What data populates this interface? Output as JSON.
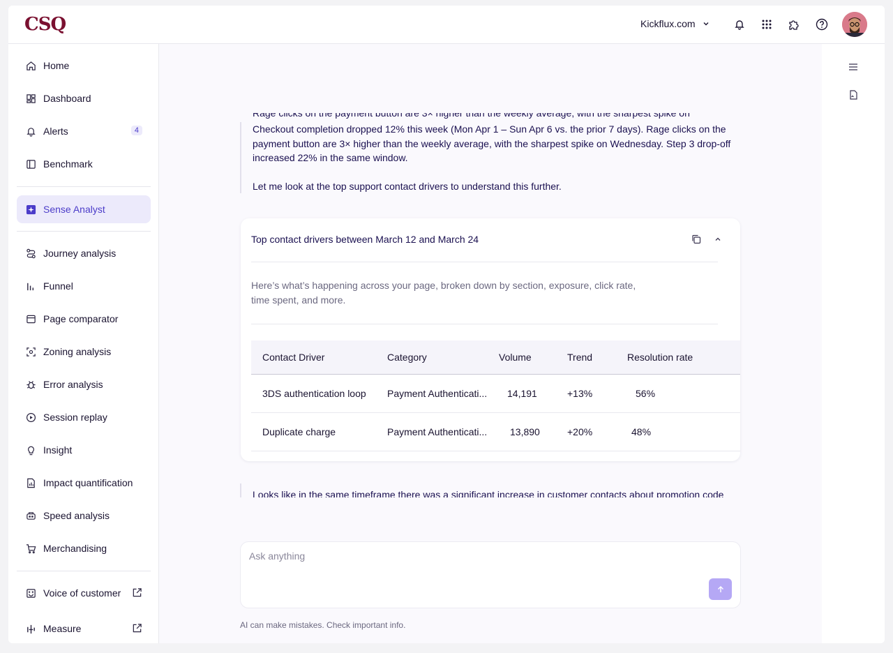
{
  "header": {
    "logo": "CSQ",
    "domain": "Kickflux.com"
  },
  "sidebar": {
    "items": [
      {
        "label": "Home",
        "icon": "home-icon"
      },
      {
        "label": "Dashboard",
        "icon": "dashboard-icon"
      },
      {
        "label": "Alerts",
        "icon": "bell-icon",
        "badge": "4"
      },
      {
        "label": "Benchmark",
        "icon": "benchmark-icon"
      },
      {
        "label": "Sense Analyst",
        "icon": "sparkle-icon",
        "active": true
      },
      {
        "label": "Journey analysis",
        "icon": "journey-icon"
      },
      {
        "label": "Funnel",
        "icon": "funnel-icon"
      },
      {
        "label": "Page comparator",
        "icon": "page-icon"
      },
      {
        "label": "Zoning analysis",
        "icon": "zoning-icon"
      },
      {
        "label": "Error analysis",
        "icon": "bug-icon"
      },
      {
        "label": "Session replay",
        "icon": "play-icon"
      },
      {
        "label": "Insight",
        "icon": "lightbulb-icon"
      },
      {
        "label": "Impact quantification",
        "icon": "report-icon"
      },
      {
        "label": "Speed analysis",
        "icon": "speed-icon"
      },
      {
        "label": "Merchandising",
        "icon": "cart-icon"
      },
      {
        "label": "Voice of customer",
        "icon": "voice-icon",
        "external": true
      },
      {
        "label": "Measure",
        "icon": "measure-icon",
        "external": true
      }
    ]
  },
  "chat": {
    "clipped_line": "Rage clicks on the payment button are 3× higher than the weekly average, with the sharpest spike on",
    "message_1": "Checkout completion dropped 12% this week (Mon Apr 1 – Sun Apr 6 vs. the prior 7 days). Rage clicks on the payment button are 3× higher than the weekly average, with the sharpest spike on Wednesday. Step 3 drop-off increased 22% in the same window.",
    "message_2": "Let me look at the top support contact drivers to understand this further.",
    "card": {
      "title": "Top contact drivers between March 12 and March 24",
      "description": "Here’s what’s happening across your page, broken down by section, exposure, click rate, time spent, and more.",
      "columns": [
        "Contact Driver",
        "Category",
        "Volume",
        "Trend",
        "Resolution rate"
      ],
      "rows": [
        [
          "3DS authentication loop",
          "Payment Authenticati...",
          "14,191",
          "+13%",
          "56%"
        ],
        [
          "Duplicate charge",
          "Payment Authenticati...",
          "13,890",
          "+20%",
          "48%"
        ]
      ]
    },
    "message_3": "Looks like in the same timeframe there was a significant increase in customer contacts about promotion code"
  },
  "composer": {
    "placeholder": "Ask anything",
    "disclaimer": "AI can make mistakes. Check important info."
  },
  "colors": {
    "accent": "#4b3cc9",
    "brand": "#7a1030",
    "send_button": "#b5a8f5"
  }
}
